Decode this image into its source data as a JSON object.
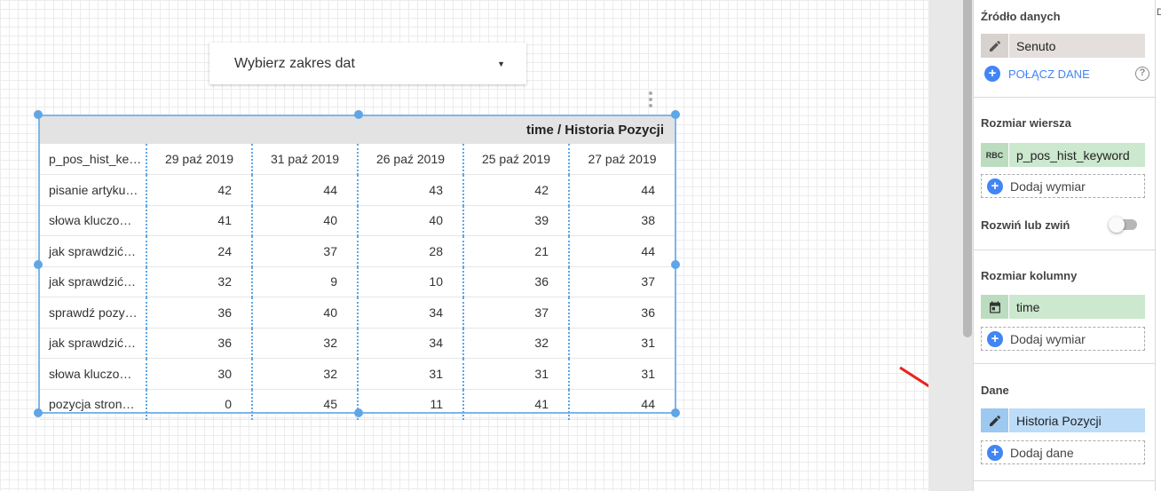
{
  "date_picker": {
    "label": "Wybierz zakres dat"
  },
  "table": {
    "header_title": "time / Historia Pozycji",
    "columns": [
      "p_pos_hist_ke…",
      "29 paź 2019",
      "31 paź 2019",
      "26 paź 2019",
      "25 paź 2019",
      "27 paź 2019"
    ],
    "rows": [
      [
        "pisanie artyku…",
        "42",
        "44",
        "43",
        "42",
        "44"
      ],
      [
        "słowa kluczo…",
        "41",
        "40",
        "40",
        "39",
        "38"
      ],
      [
        "jak sprawdzić…",
        "24",
        "37",
        "28",
        "21",
        "44"
      ],
      [
        "jak sprawdzić…",
        "32",
        "9",
        "10",
        "36",
        "37"
      ],
      [
        "sprawdź pozy…",
        "36",
        "40",
        "34",
        "37",
        "36"
      ],
      [
        "jak sprawdzić…",
        "36",
        "32",
        "34",
        "32",
        "31"
      ],
      [
        "słowa kluczo…",
        "30",
        "32",
        "31",
        "31",
        "31"
      ],
      [
        "pozycja stron…",
        "0",
        "45",
        "11",
        "41",
        "44"
      ]
    ]
  },
  "panel": {
    "data_source": {
      "title": "Źródło danych",
      "source_name": "Senuto",
      "connect_label": "POŁĄCZ DANE",
      "help_glyph": "?"
    },
    "row_dimension": {
      "title": "Rozmiar wiersza",
      "type_badge": "RBC",
      "field": "p_pos_hist_keyword",
      "add_label": "Dodaj wymiar"
    },
    "expand": {
      "label": "Rozwiń lub zwiń",
      "enabled": false
    },
    "column_dimension": {
      "title": "Rozmiar kolumny",
      "field": "time",
      "add_label": "Dodaj wymiar"
    },
    "metric": {
      "title": "Dane",
      "field": "Historia Pozycji",
      "add_label": "Dodaj dane"
    }
  },
  "right_edge_glyph": "D",
  "colors": {
    "accent_blue": "#4285f4",
    "selection_blue": "#5fa6e6",
    "arrow_red": "#e8231f"
  },
  "icons": [
    "caret-down-icon",
    "kebab-menu-icon",
    "pencil-icon",
    "plus-icon",
    "help-icon",
    "calendar-icon",
    "abc-type-icon"
  ]
}
